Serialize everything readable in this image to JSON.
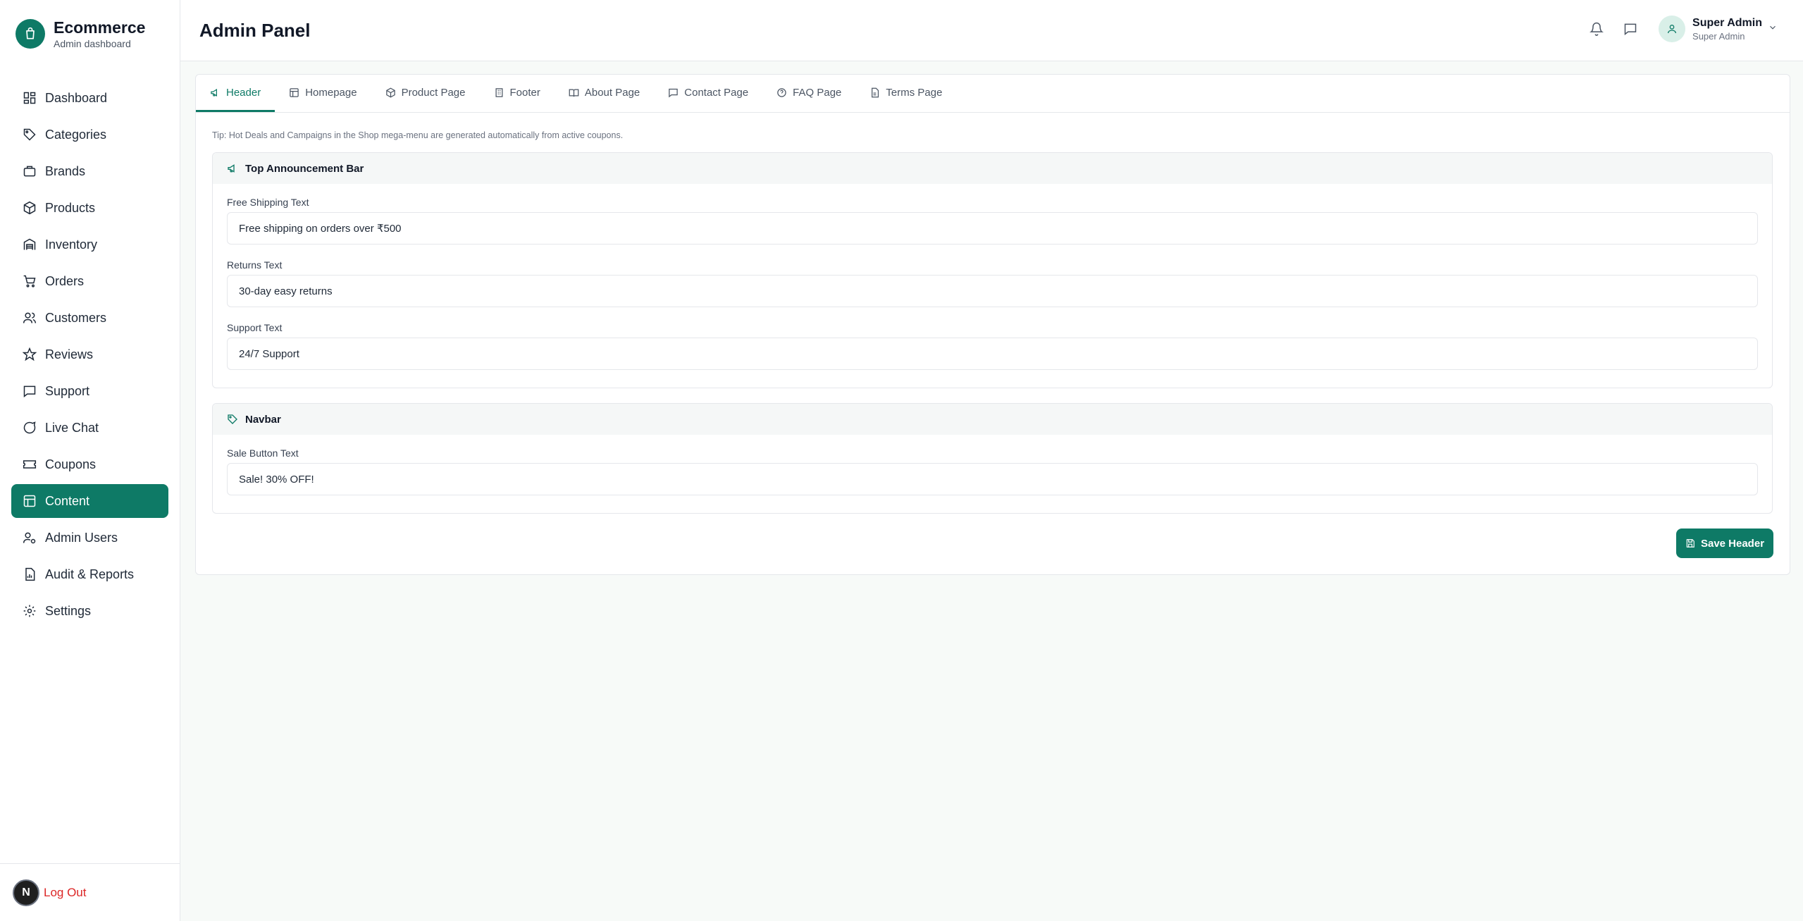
{
  "brand": {
    "title": "Ecommerce",
    "subtitle": "Admin dashboard",
    "logo_icon": "shopping-bag-icon"
  },
  "sidebar": {
    "items": [
      {
        "label": "Dashboard",
        "icon": "dashboard-icon",
        "active": false
      },
      {
        "label": "Categories",
        "icon": "tag-icon",
        "active": false
      },
      {
        "label": "Brands",
        "icon": "briefcase-icon",
        "active": false
      },
      {
        "label": "Products",
        "icon": "box-icon",
        "active": false
      },
      {
        "label": "Inventory",
        "icon": "warehouse-icon",
        "active": false
      },
      {
        "label": "Orders",
        "icon": "cart-icon",
        "active": false
      },
      {
        "label": "Customers",
        "icon": "users-icon",
        "active": false
      },
      {
        "label": "Reviews",
        "icon": "star-icon",
        "active": false
      },
      {
        "label": "Support",
        "icon": "message-square-icon",
        "active": false
      },
      {
        "label": "Live Chat",
        "icon": "message-circle-icon",
        "active": false
      },
      {
        "label": "Coupons",
        "icon": "ticket-icon",
        "active": false
      },
      {
        "label": "Content",
        "icon": "layout-icon",
        "active": true
      },
      {
        "label": "Admin Users",
        "icon": "user-cog-icon",
        "active": false
      },
      {
        "label": "Audit & Reports",
        "icon": "file-chart-icon",
        "active": false
      },
      {
        "label": "Settings",
        "icon": "gear-icon",
        "active": false
      }
    ],
    "footer": {
      "avatar_letter": "N",
      "logout_label": "Log Out"
    }
  },
  "header": {
    "title": "Admin Panel",
    "user": {
      "name": "Super Admin",
      "role": "Super Admin"
    }
  },
  "tabs": [
    {
      "label": "Header",
      "icon": "megaphone-icon",
      "active": true
    },
    {
      "label": "Homepage",
      "icon": "layout-icon",
      "active": false
    },
    {
      "label": "Product Page",
      "icon": "box-icon",
      "active": false
    },
    {
      "label": "Footer",
      "icon": "building-icon",
      "active": false
    },
    {
      "label": "About Page",
      "icon": "book-open-icon",
      "active": false
    },
    {
      "label": "Contact Page",
      "icon": "message-square-icon",
      "active": false
    },
    {
      "label": "FAQ Page",
      "icon": "help-circle-icon",
      "active": false
    },
    {
      "label": "Terms Page",
      "icon": "file-text-icon",
      "active": false
    }
  ],
  "content": {
    "tip": "Tip: Hot Deals and Campaigns in the Shop mega-menu are generated automatically from active coupons.",
    "announcement": {
      "title": "Top Announcement Bar",
      "fields": [
        {
          "label": "Free Shipping Text",
          "value": "Free shipping on orders over ₹500"
        },
        {
          "label": "Returns Text",
          "value": "30-day easy returns"
        },
        {
          "label": "Support Text",
          "value": "24/7 Support"
        }
      ]
    },
    "navbar": {
      "title": "Navbar",
      "fields": [
        {
          "label": "Sale Button Text",
          "value": "Sale! 30% OFF!"
        }
      ]
    },
    "save_label": "Save Header"
  },
  "colors": {
    "accent": "#0e7a66",
    "danger": "#dc2626",
    "background": "#f7faf8"
  }
}
